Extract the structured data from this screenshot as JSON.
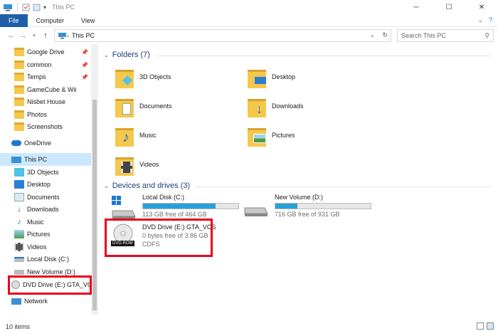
{
  "window": {
    "title": "This PC"
  },
  "ribbon": {
    "tabs": [
      "File",
      "Computer",
      "View"
    ]
  },
  "address": {
    "crumb": "This PC"
  },
  "search": {
    "placeholder": "Search This PC"
  },
  "sidebar": {
    "quick": [
      "Google Drive",
      "common",
      "Temps",
      "GameCube & Wii",
      "Nisbet House",
      "Photos",
      "Screenshots"
    ],
    "onedrive": "OneDrive",
    "thispc": "This PC",
    "pcitems": [
      "3D Objects",
      "Desktop",
      "Documents",
      "Downloads",
      "Music",
      "Pictures",
      "Videos",
      "Local Disk (C:)",
      "New Volume (D:)",
      "DVD Drive (E:) GTA_VCS"
    ],
    "network": "Network"
  },
  "folders": {
    "heading": "Folders (7)",
    "items": [
      "3D Objects",
      "Desktop",
      "Documents",
      "Downloads",
      "Music",
      "Pictures",
      "Videos"
    ]
  },
  "drives": {
    "heading": "Devices and drives (3)",
    "items": [
      {
        "name": "Local Disk (C:)",
        "free": "113 GB free of 464 GB",
        "used_fraction": 0.76
      },
      {
        "name": "New Volume (D:)",
        "free": "716 GB free of 931 GB",
        "used_fraction": 0.23
      },
      {
        "name": "DVD Drive (E:) GTA_VCS",
        "free": "0 bytes free of 3.86 GB",
        "fs": "CDFS",
        "badge": "DVD-ROM"
      }
    ]
  },
  "status": {
    "count": "10 items"
  },
  "colors": {
    "accent": "#1e5fa8",
    "selection": "#cce8ff",
    "highlight": "#e8001c",
    "folder": "#f5c84c",
    "bar": "#26a0da"
  }
}
